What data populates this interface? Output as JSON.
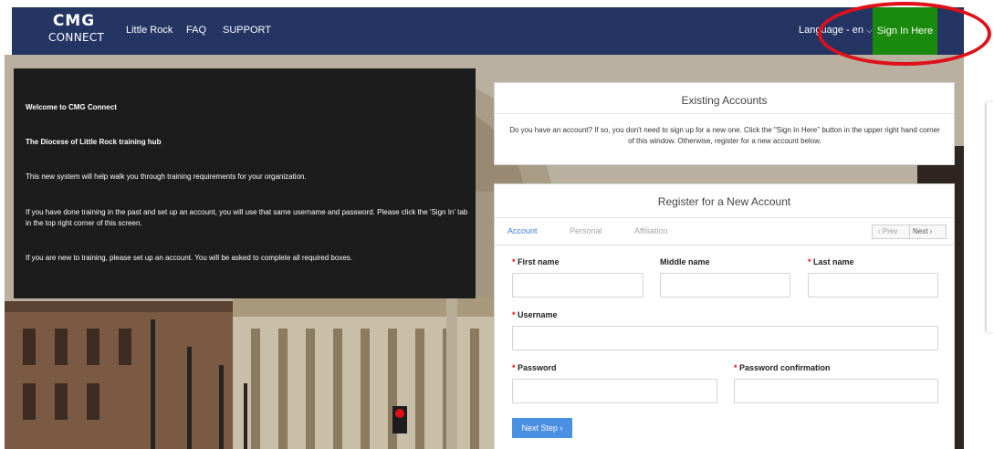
{
  "nav": {
    "logo_top": "CMG",
    "logo_bottom": "CONNECT",
    "links": [
      "Little Rock",
      "FAQ",
      "SUPPORT"
    ],
    "language_label": "Language - en",
    "language_caret": "⌵",
    "sign_in_label": "Sign In Here"
  },
  "colors": {
    "nav_background": "#243564",
    "sign_in_background": "#1a8a0c",
    "highlight_circle": "#e0101a",
    "accent_blue": "#4a8fe2"
  },
  "welcome": {
    "title": "Welcome to CMG Connect",
    "subtitle": "The Diocese of Little Rock training hub",
    "paragraph1": "This new system will help walk you through training requirements for your organization.",
    "paragraph2": "If you have done training in the past and set up an account, you will use that same username and password.  Please click the 'Sign In' tab in the top right corner of this screen.",
    "paragraph3": "If you are new to training, please set up an account.  You will be asked to complete all required boxes."
  },
  "existing_accounts": {
    "title": "Existing Accounts",
    "text": "Do you have an account? If so, you don't need to sign up for a new one. Click the \"Sign In Here\" button in the upper right hand corner of this window. Otherwise, register for a new account below."
  },
  "register": {
    "title": "Register for a New Account",
    "steps": [
      "Account",
      "Personal",
      "Affiliation"
    ],
    "active_step": "Account",
    "prev_label": "‹  Prev",
    "next_label": "Next  ›",
    "fields": {
      "first_name": "First name",
      "middle_name": "Middle name",
      "last_name": "Last name",
      "username": "Username",
      "password": "Password",
      "password_confirmation": "Password confirmation"
    },
    "required_marker": "*",
    "next_step_label": "Next Step  ›"
  }
}
